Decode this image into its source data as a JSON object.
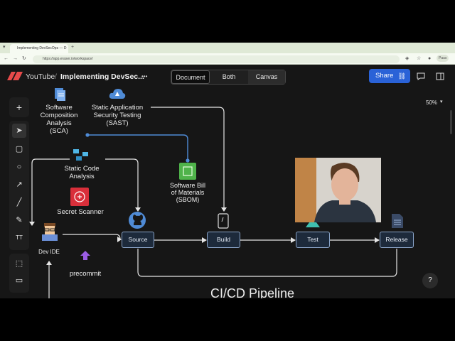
{
  "browser": {
    "tab_title": "Implementing DevSecOps — D",
    "url": "https://app.eraser.io/workspace/",
    "profile_label": "Paus"
  },
  "header": {
    "workspace": "YouTube",
    "separator": "/",
    "document_title": "Implementing DevSec...",
    "more_label": "•••",
    "view_tabs": [
      {
        "label": "Document",
        "active": true
      },
      {
        "label": "Both",
        "active": false
      },
      {
        "label": "Canvas",
        "active": false
      }
    ],
    "share_label": "Share",
    "zoom_label": "50%"
  },
  "colors": {
    "accent": "#2a62d7",
    "node_fill": "#1d2a3b",
    "node_border": "#8aa4c8",
    "connector_blue": "#4f8bd6"
  },
  "left_toolbar": {
    "items": [
      "plus-icon",
      "select-arrow-icon",
      "rectangle-icon",
      "circle-icon",
      "arrow-icon",
      "line-icon",
      "pen-icon",
      "text-icon",
      "frame-icon",
      "comment-icon"
    ]
  },
  "diagram": {
    "sca_label": "Software\nComposition\nAnalysis\n(SCA)",
    "sast_label": "Static Application\nSecurity Testing\n(SAST)",
    "static_code_label": "Static Code\nAnalysis",
    "secret_scanner_label": "Secret Scanner",
    "sbom_label": "Software Bill\nof Materials\n(SBOM)",
    "dev_ide_label": "Dev IDE",
    "precommit_label": "precommit",
    "stages": [
      "Source",
      "Build",
      "Test",
      "Release"
    ],
    "pipeline_title": "CI/CD Pipeline"
  },
  "bottom_toolbar": {
    "items": [
      "fill-color-icon",
      "connector-icon",
      "stroke-style-icon",
      "arrow-left-icon",
      "arrow-right-icon",
      "dash-icon",
      "comment-icon",
      "more-icon"
    ],
    "arrow_left": "←",
    "arrow_right": "→",
    "dash": "•••",
    "more": "•••"
  },
  "help_label": "?"
}
